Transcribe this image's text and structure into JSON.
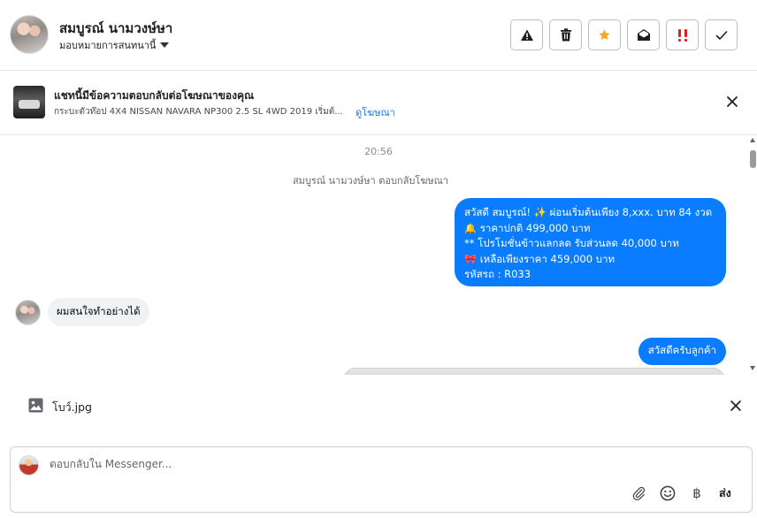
{
  "header": {
    "contact_name": "สมบูรณ์ นามวงษ์ษา",
    "assign_label": "มอบหมายการสนทนานี้"
  },
  "ad_banner": {
    "title": "แชทนี้มีข้อความตอบกลับต่อโฆษณาของคุณ",
    "subtitle": "กระบะตัวท๊อป 4X4 NISSAN NAVARA NP300 2.5 SL 4WD 2019 เริ่มต้...",
    "link": "ดูโฆษณา"
  },
  "thread": {
    "timestamp": "20:56",
    "system_note": "สมบูรณ์ นามวงษ์ษา ตอบกลับโฆษณา",
    "outgoing_1": {
      "line1": "สวัสดี สมบูรณ์! ✨  ผ่อนเริ่มต้นเพียง 8,xxx. บาท 84 งวด",
      "line2": "ราคาปกติ 499,000 บาท",
      "line3": "** โปรโมชั่นข้าวแลกลด รับส่วนลด 40,000 บาท",
      "line4": "เหลือเพียงราคา 459,000 บาท",
      "line5": " รหัสรถ : R033"
    },
    "incoming_1": "ผมสนใจทำอย่างได้",
    "outgoing_2": "สวัสดีครับลูกค้า"
  },
  "attachment": {
    "file_name": "โบว์.jpg"
  },
  "composer": {
    "placeholder": "ตอบกลับใน Messenger...",
    "baht_symbol": "฿",
    "send_label": "ส่ง"
  },
  "colors": {
    "outgoing_bubble": "#0a7cff",
    "incoming_bubble": "#f0f2f5",
    "star": "#f5a623",
    "important": "#e02020",
    "link": "#1876f2"
  },
  "icons": [
    "warning-icon",
    "trash-icon",
    "star-icon",
    "envelope-open-icon",
    "important-icon",
    "check-icon",
    "close-icon",
    "image-icon",
    "paperclip-icon",
    "emoji-icon"
  ]
}
